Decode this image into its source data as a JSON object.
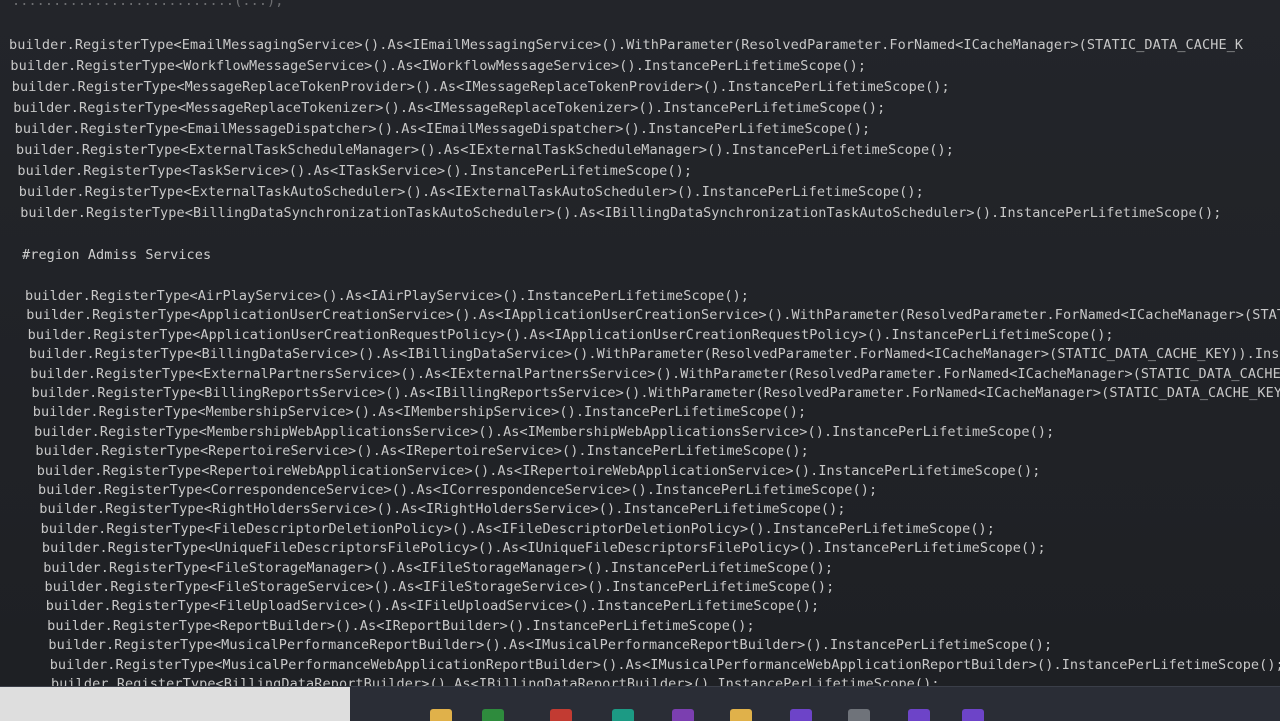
{
  "editor": {
    "top_fragment": "...........................(...);",
    "lines_group1": [
      "builder.RegisterType<EmailMessagingService>().As<IEmailMessagingService>().WithParameter(ResolvedParameter.ForNamed<ICacheManager>(STATIC_DATA_CACHE_K",
      "builder.RegisterType<WorkflowMessageService>().As<IWorkflowMessageService>().InstancePerLifetimeScope();",
      "builder.RegisterType<MessageReplaceTokenProvider>().As<IMessageReplaceTokenProvider>().InstancePerLifetimeScope();",
      "builder.RegisterType<MessageReplaceTokenizer>().As<IMessageReplaceTokenizer>().InstancePerLifetimeScope();",
      "builder.RegisterType<EmailMessageDispatcher>().As<IEmailMessageDispatcher>().InstancePerLifetimeScope();",
      "builder.RegisterType<ExternalTaskScheduleManager>().As<IExternalTaskScheduleManager>().InstancePerLifetimeScope();",
      "builder.RegisterType<TaskService>().As<ITaskService>().InstancePerLifetimeScope();",
      "builder.RegisterType<ExternalTaskAutoScheduler>().As<IExternalTaskAutoScheduler>().InstancePerLifetimeScope();",
      "builder.RegisterType<BillingDataSynchronizationTaskAutoScheduler>().As<IBillingDataSynchronizationTaskAutoScheduler>().InstancePerLifetimeScope();"
    ],
    "region": "#region Admiss Services",
    "lines_group2": [
      "builder.RegisterType<AirPlayService>().As<IAirPlayService>().InstancePerLifetimeScope();",
      "builder.RegisterType<ApplicationUserCreationService>().As<IApplicationUserCreationService>().WithParameter(ResolvedParameter.ForNamed<ICacheManager>(STAT",
      "builder.RegisterType<ApplicationUserCreationRequestPolicy>().As<IApplicationUserCreationRequestPolicy>().InstancePerLifetimeScope();",
      "builder.RegisterType<BillingDataService>().As<IBillingDataService>().WithParameter(ResolvedParameter.ForNamed<ICacheManager>(STATIC_DATA_CACHE_KEY)).Insta",
      "builder.RegisterType<ExternalPartnersService>().As<IExternalPartnersService>().WithParameter(ResolvedParameter.ForNamed<ICacheManager>(STATIC_DATA_CACHE_K",
      "builder.RegisterType<BillingReportsService>().As<IBillingReportsService>().WithParameter(ResolvedParameter.ForNamed<ICacheManager>(STATIC_DATA_CACHE_KEY))",
      "builder.RegisterType<MembershipService>().As<IMembershipService>().InstancePerLifetimeScope();",
      "builder.RegisterType<MembershipWebApplicationsService>().As<IMembershipWebApplicationsService>().InstancePerLifetimeScope();",
      "builder.RegisterType<RepertoireService>().As<IRepertoireService>().InstancePerLifetimeScope();",
      "builder.RegisterType<RepertoireWebApplicationService>().As<IRepertoireWebApplicationService>().InstancePerLifetimeScope();",
      "builder.RegisterType<CorrespondenceService>().As<ICorrespondenceService>().InstancePerLifetimeScope();",
      "builder.RegisterType<RightHoldersService>().As<IRightHoldersService>().InstancePerLifetimeScope();",
      "builder.RegisterType<FileDescriptorDeletionPolicy>().As<IFileDescriptorDeletionPolicy>().InstancePerLifetimeScope();",
      "builder.RegisterType<UniqueFileDescriptorsFilePolicy>().As<IUniqueFileDescriptorsFilePolicy>().InstancePerLifetimeScope();",
      "builder.RegisterType<FileStorageManager>().As<IFileStorageManager>().InstancePerLifetimeScope();",
      "builder.RegisterType<FileStorageService>().As<IFileStorageService>().InstancePerLifetimeScope();",
      "builder.RegisterType<FileUploadService>().As<IFileUploadService>().InstancePerLifetimeScope();",
      "builder.RegisterType<ReportBuilder>().As<IReportBuilder>().InstancePerLifetimeScope();",
      "builder.RegisterType<MusicalPerformanceReportBuilder>().As<IMusicalPerformanceReportBuilder>().InstancePerLifetimeScope();",
      "builder.RegisterType<MusicalPerformanceWebApplicationReportBuilder>().As<IMusicalPerformanceWebApplicationReportBuilder>().InstancePerLifetimeScope();",
      "builder.RegisterType<BillingDataReportBuilder>().As<IBillingDataReportBuilder>().InstancePerLifetimeScope();"
    ]
  },
  "taskbar": {
    "icons": [
      "folder-icon",
      "store-icon",
      "chrome-icon",
      "skype-icon",
      "app-icon",
      "notes-icon",
      "visual-studio-icon",
      "file-icon",
      "visual-studio-icon-2",
      "visual-studio-icon-3"
    ],
    "colors": {
      "background": "#2a2d36",
      "left_panel": "#dedede"
    }
  }
}
